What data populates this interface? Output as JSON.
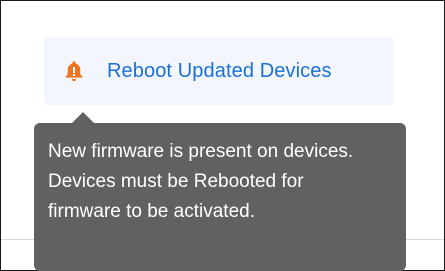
{
  "reboot": {
    "label": "Reboot Updated Devices",
    "icon": "bell-icon",
    "icon_color": "#f0741e"
  },
  "tooltip": {
    "text": "New firmware is present on devices. Devices must be Rebooted for firmware to be activated."
  },
  "colors": {
    "accent": "#1b6fd6",
    "button_bg": "#f3f7fd",
    "tooltip_bg": "#616161"
  }
}
